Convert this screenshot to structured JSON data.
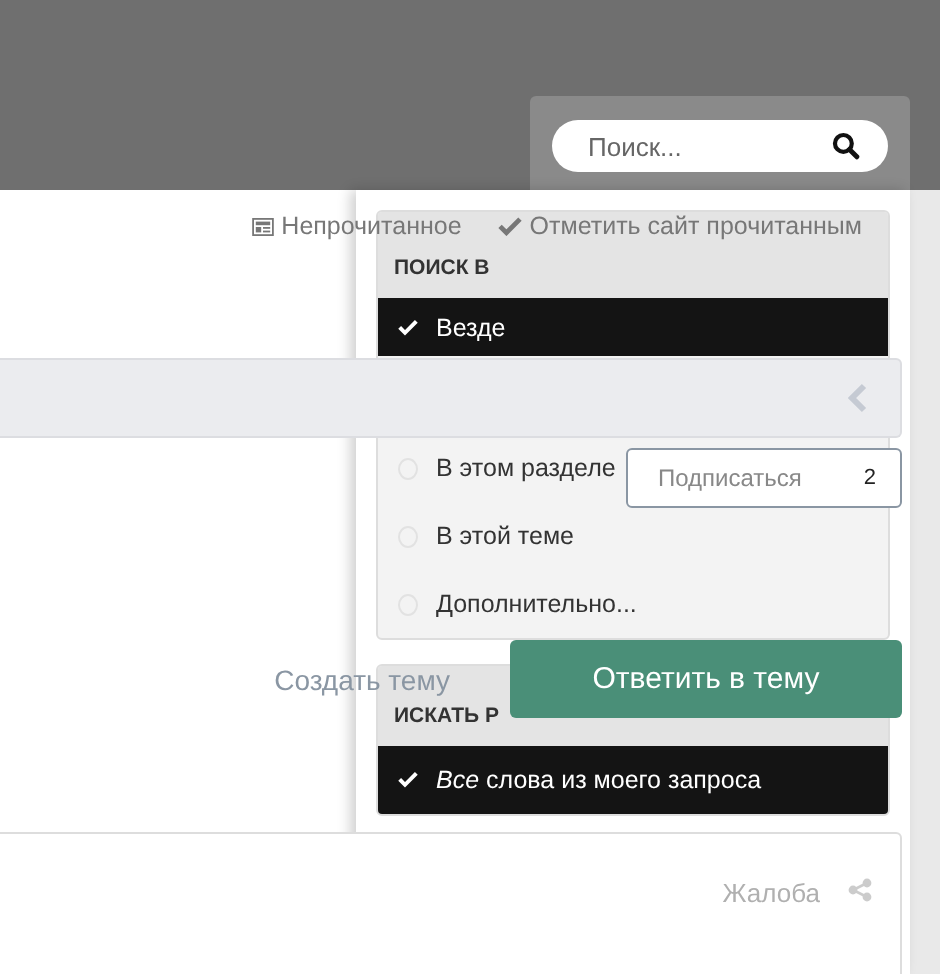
{
  "header": {
    "search": {
      "placeholder": "Поиск..."
    }
  },
  "links": [
    {
      "kind": "unread",
      "label": "Непрочитанное"
    },
    {
      "kind": "mark-read",
      "label": "Отметить сайт прочитанным"
    }
  ],
  "subscribe": {
    "label": "Подписаться",
    "count": "2"
  },
  "create_topic": "Создать тему",
  "reply_button": "Ответить в тему",
  "post": {
    "report": "Жалоба"
  },
  "search_menu": {
    "sections": [
      {
        "title": "ПОИСК В",
        "options": [
          {
            "label": "Везде",
            "selected": true
          },
          {
            "label": "В этом разделе",
            "selected": false
          },
          {
            "label": "В этой теме",
            "selected": false
          },
          {
            "label": "Дополнительно...",
            "selected": false
          }
        ]
      },
      {
        "title": "ИСКАТЬ Р",
        "options": [
          {
            "label": "*Все* слова из моего запроса",
            "selected": true
          }
        ]
      }
    ]
  }
}
